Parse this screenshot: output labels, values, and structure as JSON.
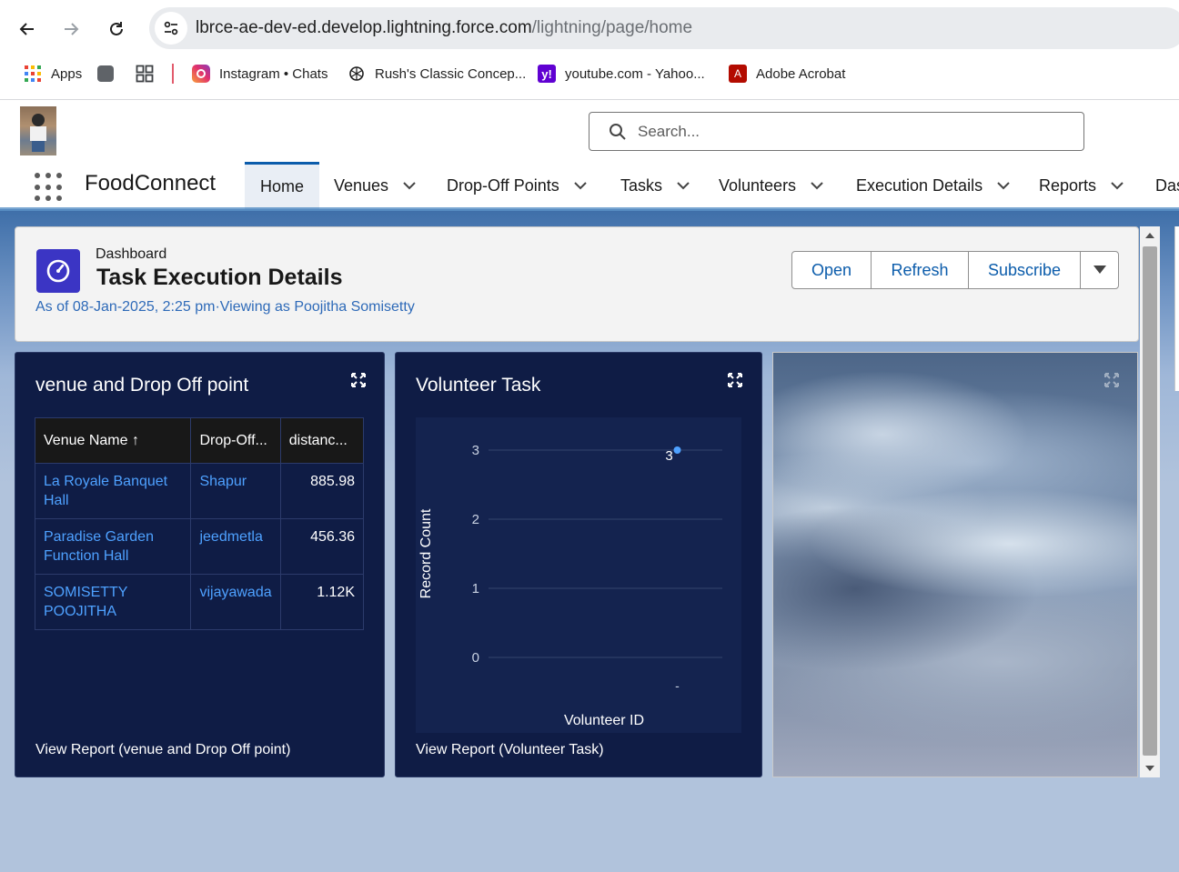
{
  "browser": {
    "url_host": "lbrce-ae-dev-ed.develop.lightning.force.com",
    "url_path": "/lightning/page/home",
    "bookmarks": [
      {
        "label": "Apps",
        "icon": "apps-grid-icon"
      },
      {
        "label": "",
        "icon": "gray-square-icon"
      },
      {
        "label": "",
        "icon": "tab-groups-icon"
      },
      {
        "label": "Instagram • Chats",
        "icon": "instagram-icon"
      },
      {
        "label": "Rush's Classic Concep...",
        "icon": "chatgpt-icon"
      },
      {
        "label": "youtube.com - Yahoo...",
        "icon": "yahoo-icon"
      },
      {
        "label": "Adobe Acrobat",
        "icon": "acrobat-icon"
      }
    ]
  },
  "header": {
    "search_placeholder": "Search...",
    "app_name": "FoodConnect",
    "tabs": [
      {
        "label": "Home",
        "active": true
      },
      {
        "label": "Venues"
      },
      {
        "label": "Drop-Off Points"
      },
      {
        "label": "Tasks"
      },
      {
        "label": "Volunteers"
      },
      {
        "label": "Execution Details"
      },
      {
        "label": "Reports"
      },
      {
        "label": "Das"
      }
    ]
  },
  "dashboard": {
    "label": "Dashboard",
    "title": "Task Execution Details",
    "subtitle": "As of 08-Jan-2025, 2:25 pm·Viewing as Poojitha Somisetty",
    "buttons": {
      "open": "Open",
      "refresh": "Refresh",
      "subscribe": "Subscribe"
    }
  },
  "components": {
    "table": {
      "title": "venue and Drop Off point",
      "columns": [
        "Venue Name ↑",
        "Drop-Off...",
        "distanc..."
      ],
      "rows": [
        {
          "venue": "La Royale Banquet Hall",
          "dropoff": "Shapur",
          "distance": "885.98"
        },
        {
          "venue": "Paradise Garden Function Hall",
          "dropoff": "jeedmetla",
          "distance": "456.36"
        },
        {
          "venue": "SOMISETTY POOJITHA",
          "dropoff": "vijayawada",
          "distance": "1.12K"
        }
      ],
      "view_report": "View Report (venue and Drop Off point)"
    },
    "chart": {
      "title": "Volunteer Task",
      "view_report": "View Report (Volunteer Task)"
    }
  },
  "chart_data": {
    "type": "scatter",
    "title": "Volunteer Task",
    "xlabel": "Volunteer ID",
    "ylabel": "Record Count",
    "categories": [
      "-"
    ],
    "values": [
      3
    ],
    "data_labels": [
      "3"
    ],
    "yticks": [
      "0",
      "1",
      "2",
      "3"
    ],
    "ylim": [
      0,
      3
    ],
    "grid": true,
    "color": "#4ea1ff"
  },
  "colors": {
    "brand_blue": "#0b5cab",
    "dashboard_icon": "#3b35c4",
    "component_bg": "#0f1c45",
    "link_blue": "#4ea1ff"
  }
}
